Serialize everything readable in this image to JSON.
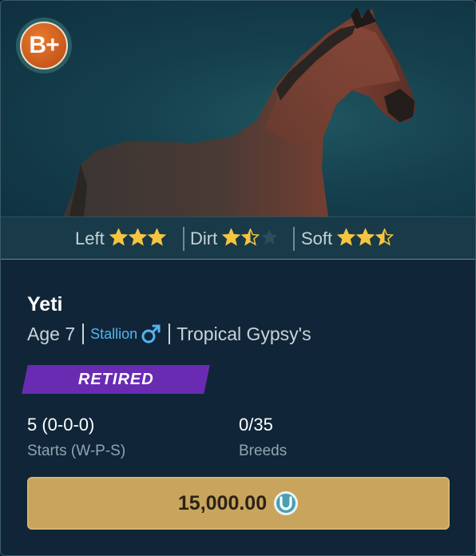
{
  "horse": {
    "grade": "B+",
    "name": "Yeti",
    "age": "Age 7",
    "gender": "Stallion",
    "farm": "Tropical Gypsy's",
    "status": "RETIRED"
  },
  "aptitudes": [
    {
      "label": "Left",
      "stars": 3,
      "max": 3
    },
    {
      "label": "Dirt",
      "stars": 1.5,
      "max": 3
    },
    {
      "label": "Soft",
      "stars": 2.5,
      "max": 3
    }
  ],
  "stats": {
    "starts_value": "5 (0-0-0)",
    "starts_label": "Starts (W-P-S)",
    "breeds_value": "0/35",
    "breeds_label": "Breeds"
  },
  "price": {
    "amount": "15,000.00",
    "currency_icon": "coin-icon"
  },
  "colors": {
    "star": "#f5c542",
    "star_empty": "#2a4e5a",
    "status": "#6a2bb3",
    "gender": "#54b4f0",
    "button": "#c9a45c"
  }
}
